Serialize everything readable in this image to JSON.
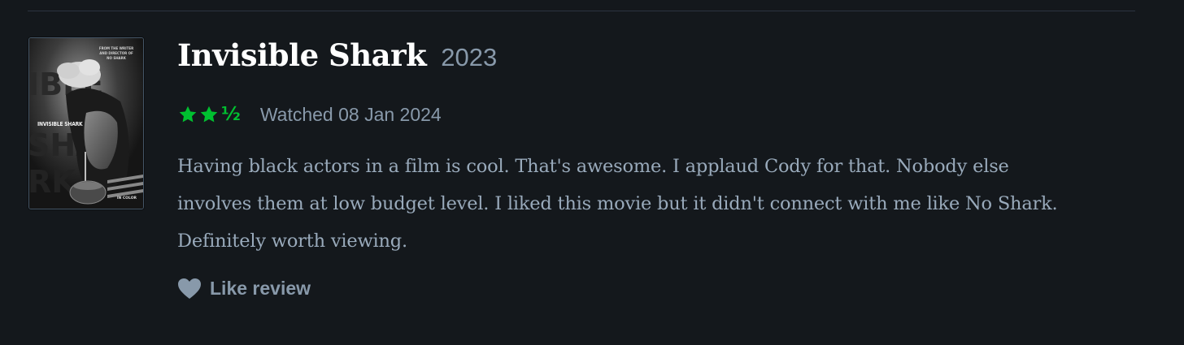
{
  "film": {
    "title": "Invisible Shark",
    "year": "2023",
    "poster": {
      "title_text": "INVISIBLE SHARK",
      "credit_text": "FROM THE WRITER AND DIRECTOR OF NO SHARK",
      "tag_text": "IN COLOR"
    }
  },
  "review": {
    "rating": 2.5,
    "rating_max": 5,
    "stars_icon": "star-icon",
    "half_glyph": "½",
    "watched": "Watched 08 Jan 2024",
    "text": "Having black actors in a film is cool. That's awesome. I applaud Cody for that. Nobody else involves them at low budget level. I liked this movie but it didn't connect with me like No Shark. Definitely worth viewing."
  },
  "actions": {
    "like_label": "Like review",
    "like_icon": "heart-icon"
  },
  "colors": {
    "background": "#14181c",
    "title": "#ffffff",
    "muted": "#8899aa",
    "body_text": "#99aabb",
    "star_green": "#00c030",
    "divider": "#2c3440"
  }
}
